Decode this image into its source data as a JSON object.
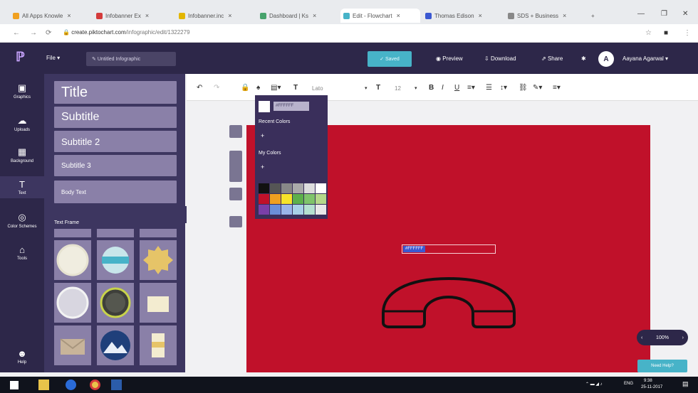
{
  "browser": {
    "tabs": [
      {
        "label": "All Apps Knowle",
        "color": "#f0a020"
      },
      {
        "label": "Infobanner Ex",
        "color": "#d43b3b"
      },
      {
        "label": "Infobanner.inc",
        "color": "#e3b600"
      },
      {
        "label": "Dashboard | Ks",
        "color": "#47a36c"
      },
      {
        "label": "Edit - Flowchart",
        "color": "#47b3c8"
      },
      {
        "label": "Thomas Edison",
        "color": "#3b58d1"
      },
      {
        "label": "SDS + Business",
        "color": "#888888"
      }
    ],
    "tab_plus": "+",
    "url_host": "create.piktochart.com",
    "url_path": "/infographic/edit/1322279"
  },
  "app": {
    "file_menu": "File ▾",
    "doc_title": "Untitled Infographic",
    "save_label": "Saved",
    "actions": {
      "preview": "Preview",
      "download": "Download",
      "share": "Share"
    },
    "user_initial": "A",
    "user_name": "Aayana Agarwal ▾"
  },
  "rail": [
    {
      "label": "Graphics",
      "icon": "graphics-icon"
    },
    {
      "label": "Uploads",
      "icon": "upload-icon"
    },
    {
      "label": "Background",
      "icon": "background-icon"
    },
    {
      "label": "Text",
      "icon": "text-icon"
    },
    {
      "label": "Color Schemes",
      "icon": "palette-icon"
    },
    {
      "label": "Tools",
      "icon": "tools-icon"
    },
    {
      "label": "Help",
      "icon": "help-icon"
    }
  ],
  "panel": {
    "text_styles": [
      "Title",
      "Subtitle",
      "Subtitle 2",
      "Subtitle 3",
      "Body Text"
    ],
    "text_frames_heading": "Text Frame"
  },
  "toolbar": {
    "font_name": "Lato",
    "font_size": "12"
  },
  "color_picker": {
    "hex_value": "#FFFFFF",
    "recent_label": "Recent Colors",
    "my_colors_label": "My Colors",
    "palette": [
      "#111111",
      "#555555",
      "#888888",
      "#aaaaaa",
      "#dddddd",
      "#ffffff",
      "#c0112a",
      "#f0a020",
      "#f6e32a",
      "#5db04b",
      "#7fc46a",
      "#b5d88a",
      "#7a3fa8",
      "#6b8fd8",
      "#9ab4e8",
      "#a8d0e6",
      "#b5e0d0",
      "#e8e8e8"
    ]
  },
  "canvas": {
    "background": "#c0112a",
    "selected_hex": "#FFFFFF",
    "zoom": "100%",
    "need_help": "Need Help?"
  },
  "taskbar": {
    "time": "9:38",
    "date": "25-11-2017",
    "lang": "ENG"
  }
}
